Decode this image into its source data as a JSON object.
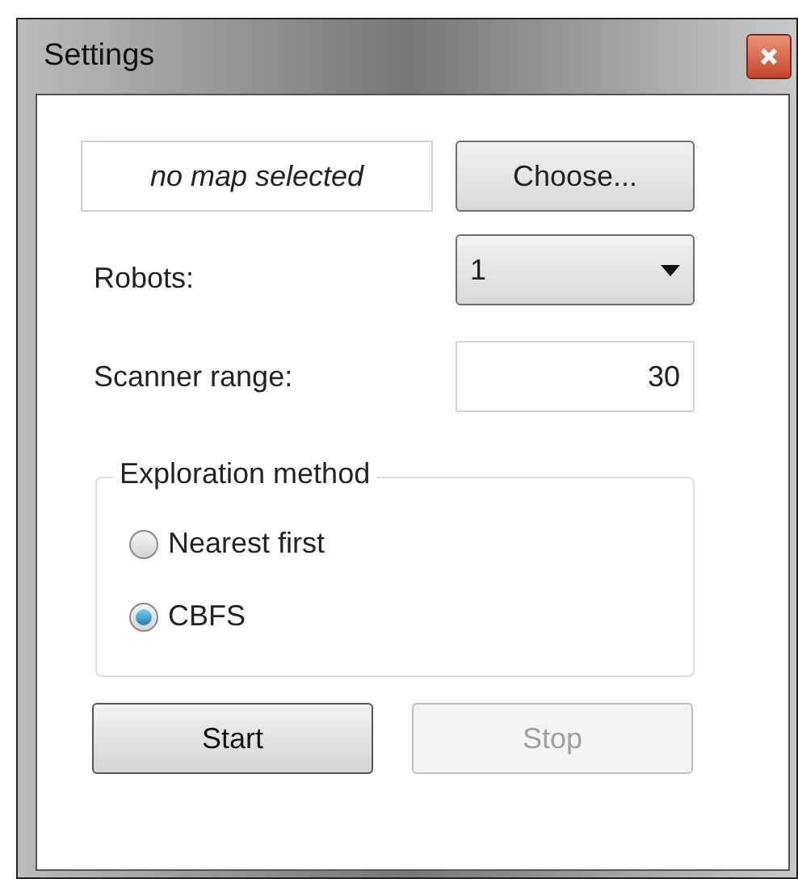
{
  "window": {
    "title": "Settings"
  },
  "map_field": {
    "value": "no map selected"
  },
  "choose_button": {
    "label": "Choose..."
  },
  "robots": {
    "label": "Robots:",
    "value": "1"
  },
  "scanner_range": {
    "label": "Scanner range:",
    "value": "30"
  },
  "exploration_method": {
    "title": "Exploration method",
    "options": [
      {
        "label": "Nearest first",
        "selected": false
      },
      {
        "label": "CBFS",
        "selected": true
      }
    ]
  },
  "buttons": [
    {
      "label": "Start",
      "disabled": false
    },
    {
      "label": "Stop",
      "disabled": true
    }
  ]
}
